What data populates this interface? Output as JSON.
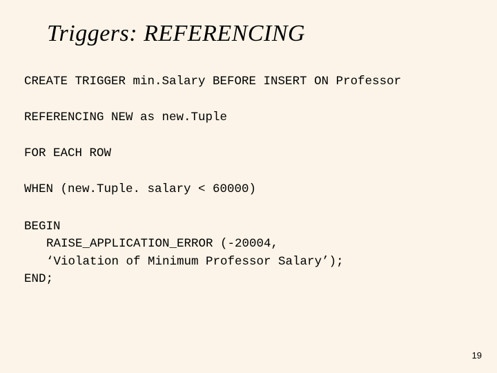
{
  "title": "Triggers: REFERENCING",
  "code": {
    "line1": "CREATE TRIGGER min.Salary BEFORE INSERT ON Professor",
    "line2": "REFERENCING NEW as new.Tuple",
    "line3": "FOR EACH ROW",
    "line4": "WHEN (new.Tuple. salary < 60000)",
    "begin": "BEGIN",
    "body1": "RAISE_APPLICATION_ERROR (-20004,",
    "body2": "‘Violation of Minimum Professor Salary’);",
    "end": "END;"
  },
  "pagenum": "19"
}
